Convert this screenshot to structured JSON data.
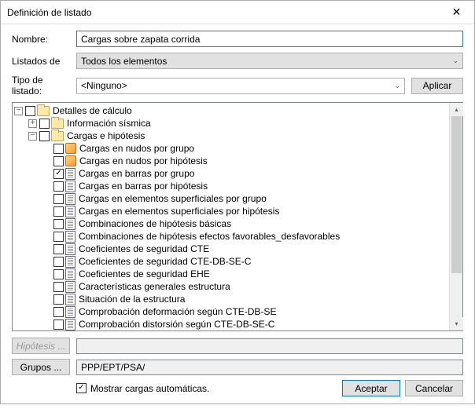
{
  "window": {
    "title": "Definición de listado"
  },
  "form": {
    "name_label": "Nombre:",
    "name_value": "Cargas sobre zapata corrida",
    "listings_of_label": "Listados de",
    "listings_of_value": "Todos los elementos",
    "listing_type_label": "Tipo de listado:",
    "listing_type_value": "<Ninguno>",
    "apply_label": "Aplicar"
  },
  "tree": {
    "root": "Detalles de cálculo",
    "seismic": "Información sísmica",
    "loads": "Cargas e hipótesis",
    "items": [
      "Cargas en nudos por grupo",
      "Cargas en nudos por hipótesis",
      "Cargas en barras por grupo",
      "Cargas en barras por hipótesis",
      "Cargas en elementos superficiales por grupo",
      "Cargas en elementos superficiales por hipótesis",
      "Combinaciones de hipótesis básicas",
      "Combinaciones de hipótesis efectos favorables_desfavorables",
      "Coeficientes de seguridad CTE",
      "Coeficientes de seguridad CTE-DB-SE-C",
      "Coeficientes de seguridad EHE",
      "Características generales estructura",
      "Situación de la estructura",
      "Comprobación deformación según CTE-DB-SE",
      "Comprobación distorsión según CTE-DB-SE-C"
    ],
    "checked": [
      false,
      false,
      true,
      false,
      false,
      false,
      false,
      false,
      false,
      false,
      false,
      false,
      false,
      false,
      false
    ]
  },
  "bottom": {
    "hypothesis_btn": "Hipótesis ...",
    "groups_btn": "Grupos ...",
    "groups_value": "PPP/EPT/PSA/",
    "show_auto_loads": "Mostrar cargas automáticas."
  },
  "actions": {
    "accept": "Aceptar",
    "cancel": "Cancelar"
  }
}
